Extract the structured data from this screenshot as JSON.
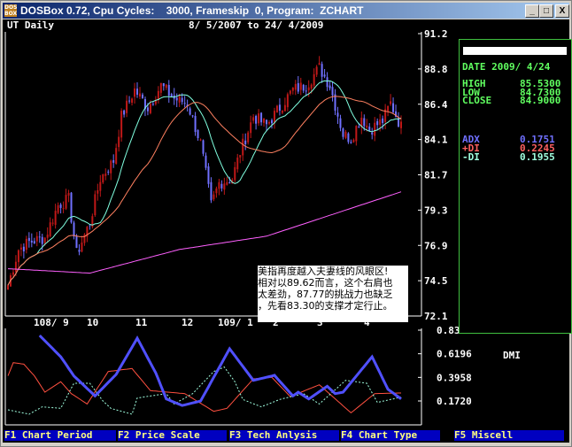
{
  "window": {
    "title": "DOSBox 0.72, Cpu Cycles:    3000, Frameskip  0, Program:  ZCHART",
    "logo": "DOS BOX",
    "min": "_",
    "max": "□",
    "close": "X"
  },
  "header": {
    "symbol": "UT Daily",
    "range": "8/ 5/2007 to 24/ 4/2009"
  },
  "panel": {
    "date": "DATE 2009/ 4/24",
    "high_label": "HIGH",
    "high": "85.5300",
    "low_label": "LOW",
    "low": "84.7300",
    "close_label": "CLOSE",
    "close": "84.9000",
    "adx_label": "ADX",
    "adx": "0.1751",
    "pdi_label": "+DI",
    "pdi": "0.2245",
    "mdi_label": "-DI",
    "mdi": "0.1955"
  },
  "note": {
    "lines": [
      "美指再度越入夫妻线的风眼区!",
      "相对以89.62而言，这个右肩也",
      "太差劲，87.77的挑战力也缺乏",
      "，先看83.30的支撑才定行止。"
    ]
  },
  "menu": [
    "F1 Chart Period",
    "F2 Price Scale",
    "F3 Tech Anlysis",
    "F4 Chart Type",
    "F5 Miscell"
  ],
  "colors": {
    "up": "#c01818",
    "down": "#7070ff",
    "ma_short": "#80ffe0",
    "ma_mid": "#ff8060",
    "ma_long": "#ff60ff",
    "adx": "#5050ff",
    "pdi": "#ff5040",
    "mdi": "#a0ffe0",
    "panel_border": "#40c040",
    "panel_text": "#60ff60",
    "menu_bg": "#0000c0",
    "menu_text": "#ffff80"
  },
  "chart_data": [
    {
      "type": "candlestick",
      "title": "UT Daily",
      "ylim": [
        72.1,
        91.2
      ],
      "yticks": [
        "91.2",
        "88.8",
        "86.4",
        "84.1",
        "81.7",
        "79.3",
        "76.9",
        "74.5",
        "72.1"
      ],
      "xticks": [
        "108/ 9",
        "10",
        "11",
        "12",
        "109/ 1",
        "2",
        "3",
        "4"
      ],
      "close_path": [
        [
          0,
          74.2
        ],
        [
          4,
          76.6
        ],
        [
          8,
          77.1
        ],
        [
          14,
          77.4
        ],
        [
          19,
          79.6
        ],
        [
          23,
          80
        ],
        [
          26,
          76.3
        ],
        [
          31,
          78.4
        ],
        [
          35,
          81.4
        ],
        [
          40,
          82.6
        ],
        [
          43,
          85.6
        ],
        [
          48,
          87.4
        ],
        [
          53,
          86.2
        ],
        [
          58,
          87.7
        ],
        [
          63,
          86.8
        ],
        [
          68,
          86.5
        ],
        [
          73,
          83.8
        ],
        [
          77,
          79.6
        ],
        [
          80,
          81.1
        ],
        [
          85,
          81.4
        ],
        [
          88,
          83.2
        ],
        [
          93,
          85.6
        ],
        [
          98,
          85
        ],
        [
          103,
          86.2
        ],
        [
          108,
          87.4
        ],
        [
          113,
          87.7
        ],
        [
          118,
          88.9
        ],
        [
          122,
          87.7
        ],
        [
          127,
          84.4
        ],
        [
          130,
          84.1
        ],
        [
          134,
          85.6
        ],
        [
          137,
          84.7
        ],
        [
          142,
          85.3
        ],
        [
          145,
          86.5
        ],
        [
          149,
          84.9
        ]
      ],
      "ma_long_path": [
        [
          0,
          75.3
        ],
        [
          31,
          75
        ],
        [
          65,
          76.6
        ],
        [
          98,
          77.5
        ],
        [
          149,
          80.5
        ]
      ]
    },
    {
      "type": "line",
      "title": "DMI",
      "yticks": [
        "0.8351",
        "0.6196",
        "0.3958",
        "0.1720"
      ],
      "series": [
        {
          "name": "ADX",
          "points": [
            [
              12,
              0.785
            ],
            [
              20,
              0.586
            ],
            [
              25,
              0.406
            ],
            [
              33,
              0.219
            ],
            [
              41,
              0.421
            ],
            [
              49,
              0.76
            ],
            [
              56,
              0.435
            ],
            [
              60,
              0.191
            ],
            [
              66,
              0.13
            ],
            [
              73,
              0.171
            ],
            [
              84,
              0.661
            ],
            [
              93,
              0.365
            ],
            [
              101,
              0.412
            ],
            [
              108,
              0.219
            ],
            [
              110,
              0.254
            ],
            [
              114,
              0.191
            ],
            [
              121,
              0.31
            ],
            [
              124,
              0.241
            ],
            [
              127,
              0.254
            ],
            [
              138,
              0.586
            ],
            [
              144,
              0.282
            ],
            [
              149,
              0.191
            ]
          ]
        },
        {
          "name": "+DI",
          "points": [
            [
              0,
              0.407
            ],
            [
              2,
              0.531
            ],
            [
              6,
              0.517
            ],
            [
              10,
              0.407
            ],
            [
              14,
              0.255
            ],
            [
              20,
              0.352
            ],
            [
              24,
              0.241
            ],
            [
              30,
              0.144
            ],
            [
              38,
              0.448
            ],
            [
              47,
              0.476
            ],
            [
              54,
              0.269
            ],
            [
              67,
              0.241
            ],
            [
              78,
              0.075
            ],
            [
              83,
              0.103
            ],
            [
              93,
              0.379
            ],
            [
              100,
              0.393
            ],
            [
              107,
              0.213
            ],
            [
              118,
              0.324
            ],
            [
              130,
              0.061
            ],
            [
              139,
              0.241
            ],
            [
              149,
              0.247
            ]
          ]
        },
        {
          "name": "-DI",
          "points": [
            [
              0,
              0.089
            ],
            [
              8,
              0.048
            ],
            [
              13,
              0.117
            ],
            [
              20,
              0.103
            ],
            [
              25,
              0.338
            ],
            [
              31,
              0.338
            ],
            [
              36,
              0.172
            ],
            [
              39,
              0.103
            ],
            [
              47,
              0.048
            ],
            [
              49,
              0.2
            ],
            [
              60,
              0.241
            ],
            [
              63,
              0.144
            ],
            [
              70,
              0.241
            ],
            [
              78,
              0.448
            ],
            [
              82,
              0.49
            ],
            [
              86,
              0.352
            ],
            [
              89,
              0.186
            ],
            [
              96,
              0.117
            ],
            [
              103,
              0.186
            ],
            [
              112,
              0.241
            ],
            [
              118,
              0.144
            ],
            [
              128,
              0.365
            ],
            [
              136,
              0.338
            ],
            [
              140,
              0.158
            ],
            [
              149,
              0.208
            ]
          ]
        }
      ]
    }
  ]
}
